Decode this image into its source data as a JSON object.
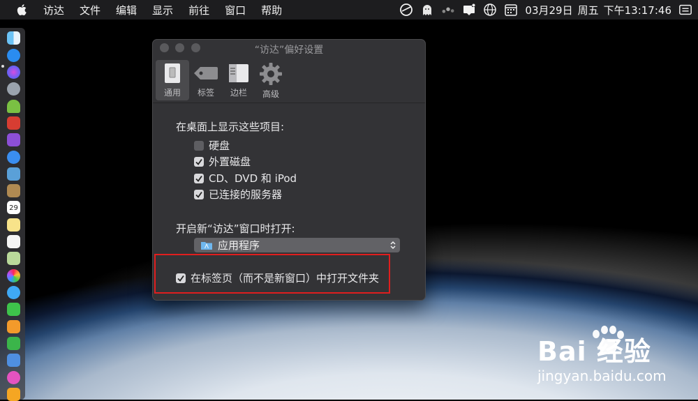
{
  "menubar": {
    "items": [
      "访达",
      "文件",
      "编辑",
      "显示",
      "前往",
      "窗口",
      "帮助"
    ],
    "status_icons": [
      "clock-check-icon",
      "ghost-icon",
      "dots-icon",
      "notification-icon",
      "globe-icon",
      "calendar-icon",
      "menu-extra-icon"
    ],
    "date": "03月29日",
    "weekday": "周五",
    "time": "下午13:17:46"
  },
  "dock": {
    "icons": [
      "finder-icon",
      "app-store-icon",
      "siri-icon",
      "launchpad-icon",
      "android-icon",
      "app-red-icon",
      "app-purple-icon",
      "safari-icon",
      "preview-icon",
      "notes-brown-icon",
      "calendar-icon",
      "stickies-icon",
      "reminders-icon",
      "maps-icon",
      "photos-icon",
      "messages-icon",
      "facetime-icon",
      "pages-icon",
      "numbers-icon",
      "keynote-icon",
      "itunes-icon",
      "books-icon"
    ],
    "calendar_day": "29"
  },
  "window": {
    "title": "“访达”偏好设置",
    "tabs": [
      {
        "label": "通用",
        "icon": "switch-icon",
        "active": true
      },
      {
        "label": "标签",
        "icon": "tag-icon",
        "active": false
      },
      {
        "label": "边栏",
        "icon": "sidebar-icon",
        "active": false
      },
      {
        "label": "高级",
        "icon": "gear-icon",
        "active": false
      }
    ],
    "desktop_section_label": "在桌面上显示这些项目:",
    "desktop_items": [
      {
        "label": "硬盘",
        "checked": false
      },
      {
        "label": "外置磁盘",
        "checked": true
      },
      {
        "label": "CD、DVD 和 iPod",
        "checked": true
      },
      {
        "label": "已连接的服务器",
        "checked": true
      }
    ],
    "new_window_label": "开启新“访达”窗口时打开:",
    "new_window_value": "应用程序",
    "tabs_option": {
      "label": "在标签页（而不是新窗口）中打开文件夹",
      "checked": true
    }
  },
  "watermark": {
    "main": "Bai 经验",
    "sub": "jingyan.baidu.com"
  }
}
